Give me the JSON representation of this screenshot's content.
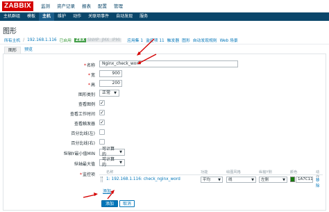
{
  "header": {
    "logo": "ZABBIX",
    "menu": [
      "监测",
      "资产记录",
      "报表",
      "配置",
      "管理"
    ]
  },
  "submenu": {
    "items": [
      "主机群组",
      "模板",
      "主机",
      "维护",
      "动作",
      "关联项事件",
      "自动发现",
      "服务"
    ],
    "active_index": 2
  },
  "page": {
    "title": "图形"
  },
  "breadcrumb": {
    "all_hosts": "所有主机",
    "separator": "/",
    "host": "192.168.1.116",
    "status": "已启用",
    "avail": [
      "ZBX",
      "SNMP",
      "JMX",
      "IPMI"
    ],
    "links": [
      "应用集 1",
      "监控项 11",
      "触发器",
      "图形",
      "自动发现规则",
      "Web 场景"
    ]
  },
  "tabs": [
    "图形",
    "预览"
  ],
  "form": {
    "name_label": "名称",
    "name_value": "Nginx_check_work",
    "width_label": "宽",
    "width_value": "900",
    "height_label": "高",
    "height_value": "200",
    "graph_type_label": "图形类别",
    "graph_type_value": "正常",
    "show_legend_label": "查看图例",
    "show_working_time_label": "查看工作时间",
    "show_triggers_label": "查看触发器",
    "percentile_left_label": "百分比线(左)",
    "percentile_right_label": "百分比线(右)",
    "ymin_label": "纵轴Y最小值MIN",
    "ymin_value": "可计算的",
    "ymax_label": "纵轴最大值",
    "ymax_value": "可计算的",
    "items_label": "监控项",
    "checkbox_states": {
      "show_legend": true,
      "show_working_time": true,
      "show_triggers": true,
      "percentile_left": false,
      "percentile_right": false
    }
  },
  "items_table": {
    "headers": [
      "名称",
      "功能",
      "绘图风格",
      "纵轴Y侧",
      "颜色",
      "动作"
    ],
    "rows": [
      {
        "index": "1:",
        "name": "192.168.1.116: check_nginx_word",
        "function": "平均",
        "style": "线",
        "y_axis_side": "左侧",
        "color": "1A7C11",
        "action": "移除"
      }
    ],
    "add_label": "添加"
  },
  "buttons": {
    "add": "添加",
    "cancel": "取消"
  },
  "colors": {
    "brand": "#d40000",
    "nav": "#0a466a",
    "link": "#0275b8",
    "swatch": "#1a7c11",
    "arrow": "#d40000"
  }
}
